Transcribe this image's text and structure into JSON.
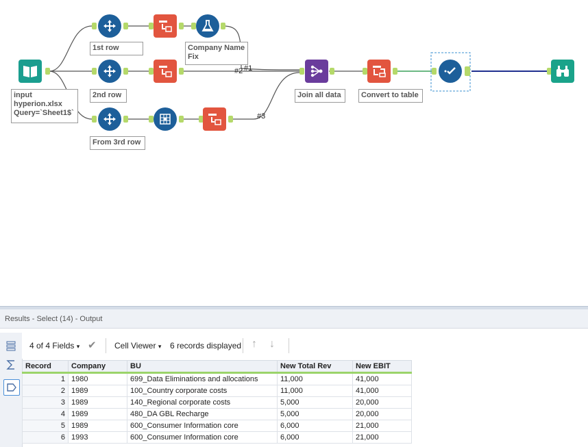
{
  "workflow": {
    "labels": {
      "input": [
        "input",
        "hyperion.xlsx",
        "Query=`Sheet1$`"
      ],
      "row1": "1st row",
      "row2": "2nd row",
      "row3": "From 3rd row",
      "company_fix": [
        "Company Name",
        "Fix"
      ],
      "join": "Join all data",
      "convert": "Convert to table"
    },
    "connections": {
      "c1": "#1",
      "c2": "#2",
      "c3": "#3"
    }
  },
  "results": {
    "title": "Results - Select (14) - Output",
    "toolbar": {
      "fields": "4 of 4 Fields",
      "viewer": "Cell Viewer",
      "records": "6 records displayed"
    },
    "columns": [
      "Record",
      "Company",
      "BU",
      "New Total Rev",
      "New EBIT"
    ],
    "rows": [
      [
        "1",
        "1980",
        "699_Data Eliminations and allocations",
        "11,000",
        "41,000"
      ],
      [
        "2",
        "1989",
        "100_Country corporate costs",
        "11,000",
        "41,000"
      ],
      [
        "3",
        "1989",
        "140_Regional corporate costs",
        "5,000",
        "20,000"
      ],
      [
        "4",
        "1989",
        "480_DA GBL Recharge",
        "5,000",
        "20,000"
      ],
      [
        "5",
        "1989",
        "600_Consumer Information core",
        "6,000",
        "21,000"
      ],
      [
        "6",
        "1993",
        "600_Consumer Information core",
        "6,000",
        "21,000"
      ]
    ]
  },
  "colors": {
    "input_teal": "#1a9e8f",
    "select_blue": "#1d5f9a",
    "formula_blue": "#1d5f9a",
    "sample_red": "#e2553f",
    "join_purple": "#6a3c9c",
    "browse_teal": "#1aa38a",
    "anchor_green": "#b5d96a",
    "header_underline": "#9bd46a"
  }
}
